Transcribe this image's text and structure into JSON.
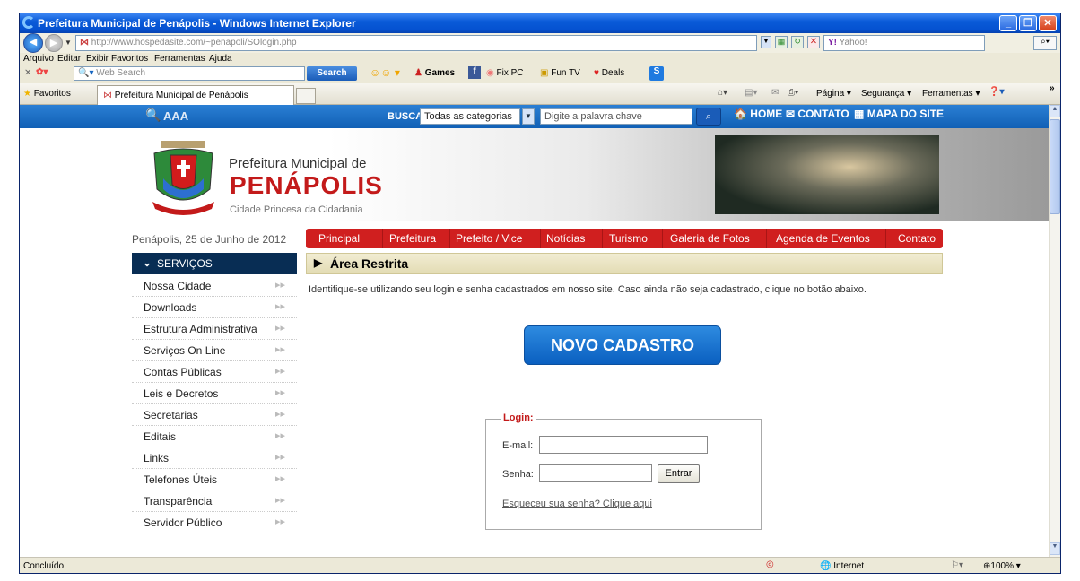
{
  "window": {
    "title": "Prefeitura Municipal de Penápolis - Windows Internet Explorer"
  },
  "address": {
    "url": "http://www.hospedasite.com/~penapoli/SOlogin.php",
    "search_placeholder": "Yahoo!"
  },
  "menu": [
    "Arquivo",
    "Editar",
    "Exibir",
    "Favoritos",
    "Ferramentas",
    "Ajuda"
  ],
  "toolbar": {
    "search_placeholder": "Web Search",
    "search_button": "Search",
    "games": "Games",
    "fixpc": "Fix PC",
    "funtv": "Fun TV",
    "deals": "Deals"
  },
  "favorites": {
    "label": "Favoritos",
    "tab": "Prefeitura Municipal de Penápolis",
    "page_menu": "Página",
    "security_menu": "Segurança",
    "tools_menu": "Ferramentas"
  },
  "site": {
    "font_size": "AAA",
    "search_label": "BUSCA:",
    "search_category": "Todas as categorias",
    "search_placeholder": "Digite a palavra chave",
    "links": {
      "home": "HOME",
      "contact": "CONTATO",
      "sitemap": "MAPA DO SITE"
    },
    "brand_line1": "Prefeitura Municipal de",
    "brand_name": "PENÁPOLIS",
    "brand_tagline": "Cidade Princesa da Cidadania",
    "date": "Penápolis, 25 de Junho de 2012",
    "nav": [
      "Principal",
      "Prefeitura",
      "Prefeito / Vice",
      "Notícias",
      "Turismo",
      "Galeria de Fotos",
      "Agenda de Eventos",
      "Contato"
    ],
    "services_title": "SERVIÇOS",
    "services": [
      "Nossa Cidade",
      "Downloads",
      "Estrutura Administrativa",
      "Serviços On Line",
      "Contas Públicas",
      "Leis e Decretos",
      "Secretarias",
      "Editais",
      "Links",
      "Telefones Úteis",
      "Transparência",
      "Servidor Público"
    ],
    "area_title": "Área Restrita",
    "instructions": "Identifique-se utilizando seu login e senha cadastrados em nosso site. Caso ainda não seja cadastrado, clique no botão abaixo.",
    "new_signup": "NOVO CADASTRO",
    "login": {
      "legend": "Login:",
      "email_label": "E-mail:",
      "password_label": "Senha:",
      "submit": "Entrar",
      "forgot": "Esqueceu sua senha? Clique aqui"
    }
  },
  "status": {
    "text": "Concluído",
    "zone": "Internet",
    "zoom": "100%"
  },
  "colors": {
    "nav_red": "#d01f1f",
    "sidebar_dark": "#082d54",
    "top_blue": "#1a6fc8",
    "brand_red": "#c31a1a"
  }
}
